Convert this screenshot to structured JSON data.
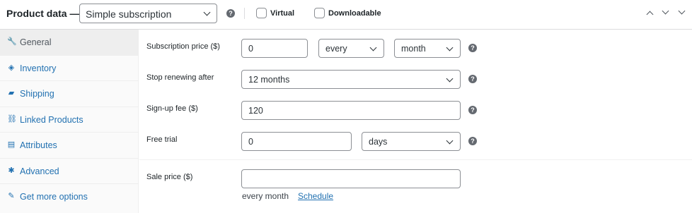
{
  "header": {
    "title": "Product data —",
    "product_type": "Simple subscription",
    "virtual_label": "Virtual",
    "downloadable_label": "Downloadable",
    "help_glyph": "?"
  },
  "sidebar": {
    "items": [
      {
        "label": "General",
        "icon": "wrench-icon",
        "glyph": "🔧",
        "active": true
      },
      {
        "label": "Inventory",
        "icon": "tag-icon",
        "glyph": "◈",
        "active": false
      },
      {
        "label": "Shipping",
        "icon": "truck-icon",
        "glyph": "▰",
        "active": false
      },
      {
        "label": "Linked Products",
        "icon": "link-icon",
        "glyph": "⛓",
        "active": false
      },
      {
        "label": "Attributes",
        "icon": "list-icon",
        "glyph": "▤",
        "active": false
      },
      {
        "label": "Advanced",
        "icon": "gear-icon",
        "glyph": "✱",
        "active": false
      },
      {
        "label": "Get more options",
        "icon": "plugin-icon",
        "glyph": "✎",
        "active": false
      }
    ]
  },
  "fields": {
    "subscription_price": {
      "label": "Subscription price ($)",
      "value": "0",
      "interval": "every",
      "period": "month"
    },
    "stop_renewing": {
      "label": "Stop renewing after",
      "value": "12 months"
    },
    "signup_fee": {
      "label": "Sign-up fee ($)",
      "value": "120"
    },
    "free_trial": {
      "label": "Free trial",
      "value": "0",
      "unit": "days"
    },
    "sale_price": {
      "label": "Sale price ($)",
      "value": "",
      "note": "every month",
      "schedule_link": "Schedule"
    }
  }
}
